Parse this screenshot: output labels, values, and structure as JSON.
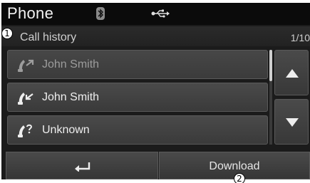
{
  "header": {
    "title": "Phone",
    "bluetooth_icon": "bluetooth-icon",
    "usb_icon": "usb-icon"
  },
  "subheader": {
    "callout": "1",
    "title": "Call history",
    "page_count": "1/10"
  },
  "call_list": [
    {
      "name": "John Smith",
      "type": "outgoing-call-icon",
      "dimmed": true
    },
    {
      "name": "John Smith",
      "type": "incoming-call-icon",
      "dimmed": false
    },
    {
      "name": "Unknown",
      "type": "missed-call-icon",
      "dimmed": false
    }
  ],
  "scroll": {
    "up_icon": "arrow-up-icon",
    "down_icon": "arrow-down-icon"
  },
  "footer": {
    "back_icon": "back-icon",
    "download_label": "Download",
    "callout": "2"
  },
  "colors": {
    "background": "#1b1b1b",
    "button": "#444444",
    "text": "#eeeeee",
    "dimmed_text": "#9c9c9c"
  }
}
